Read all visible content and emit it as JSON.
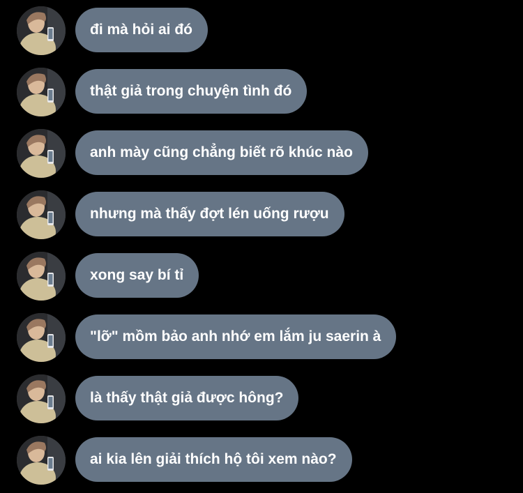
{
  "messages": [
    {
      "text": "đi mà hỏi ai đó"
    },
    {
      "text": "thật giả trong chuyện tình đó"
    },
    {
      "text": "anh mày cũng chẳng biết rõ khúc nào"
    },
    {
      "text": "nhưng mà thấy đợt lén uống rượu"
    },
    {
      "text": "xong say bí tỉ"
    },
    {
      "text": "\"lỡ\" mồm bảo anh nhớ em lắm ju saerin à"
    },
    {
      "text": "là thấy thật giả được hông?"
    },
    {
      "text": "ai kia lên giải thích hộ tôi xem nào?"
    }
  ],
  "colors": {
    "background": "#000000",
    "bubble": "#667586",
    "text": "#ffffff"
  }
}
